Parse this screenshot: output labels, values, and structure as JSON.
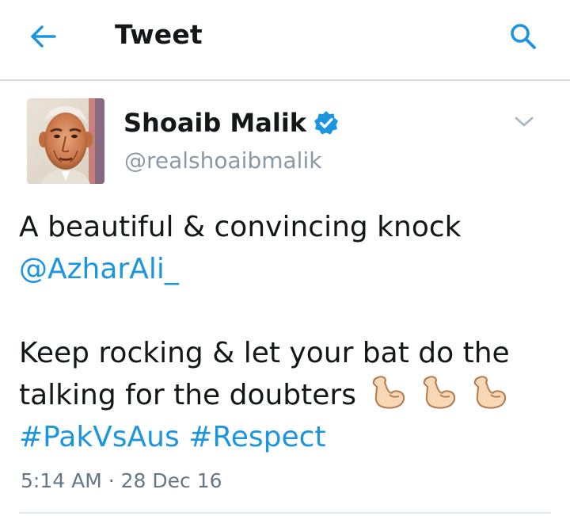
{
  "header": {
    "back_icon": "arrow-left-icon",
    "title": "Tweet",
    "search_icon": "search-icon",
    "accent_color": "#1b95e0"
  },
  "tweet": {
    "author_name": "Shoaib Malik",
    "author_handle": "@realshoaibmalik",
    "verified_icon": "verified-badge-icon",
    "menu_icon": "chevron-down-icon",
    "text_line_1": "A beautiful & convincing knock",
    "mention": "@AzharAli_",
    "text_line_2": "Keep rocking & let your bat do the",
    "text_line_3": "talking for the doubters",
    "emoji": [
      "flexed-biceps",
      "flexed-biceps",
      "flexed-biceps"
    ],
    "hashtag_1": "#PakVsAus",
    "hashtag_2": "#Respect",
    "time": "5:14 AM",
    "separator": "·",
    "date": "28 Dec 16"
  }
}
